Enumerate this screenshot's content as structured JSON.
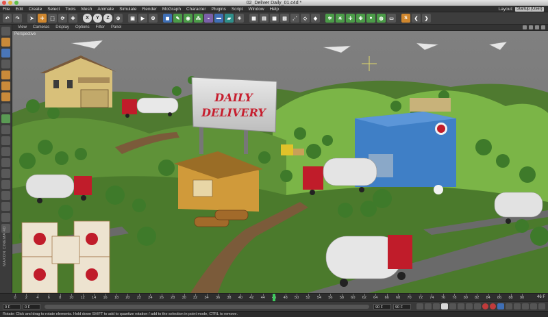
{
  "window": {
    "title": "02_Deliver Daily_01.c4d *"
  },
  "menu": {
    "items": [
      "File",
      "Edit",
      "Create",
      "Select",
      "Tools",
      "Mesh",
      "Animate",
      "Simulate",
      "Render",
      "MoGraph",
      "Character",
      "Plugins",
      "Script",
      "Window",
      "Help"
    ],
    "layout_label": "Layout:",
    "layout_value": "Startup (User)"
  },
  "toolbar": {
    "axis_x": "X",
    "axis_y": "Y",
    "axis_z": "Z"
  },
  "viewport": {
    "menu": [
      "View",
      "Cameras",
      "Display",
      "Options",
      "Filter",
      "Panel"
    ],
    "camera_label": "Perspective",
    "billboard_line1": "DAILY",
    "billboard_line2": "DELIVERY"
  },
  "timeline": {
    "ticks": [
      "0",
      "2",
      "4",
      "6",
      "8",
      "10",
      "12",
      "14",
      "16",
      "18",
      "20",
      "22",
      "24",
      "26",
      "28",
      "30",
      "32",
      "34",
      "36",
      "38",
      "40",
      "42",
      "44",
      "46",
      "48",
      "50",
      "52",
      "54",
      "56",
      "58",
      "60",
      "62",
      "64",
      "66",
      "68",
      "70",
      "72",
      "74",
      "76",
      "78",
      "80",
      "82",
      "84",
      "86",
      "88",
      "90"
    ],
    "current_frame": 46,
    "end_label": "46 F"
  },
  "transport": {
    "start_frame": "0 F",
    "min_field": "0 F",
    "max_field": "90 F",
    "end_frame": "90 F"
  },
  "status": {
    "text": "Rotate: Click and drag to rotate elements. Hold down SHIFT to add to quantize rotation / add to the selection in point mode, CTRL to remove."
  },
  "colors": {
    "grass": "#5a8a3a",
    "hill": "#6fa33f",
    "road": "#6b6b6b",
    "dirt": "#8a6a45",
    "building_blue": "#3f7fc6",
    "billboard_text": "#c61e2e",
    "truck_red": "#c01c2a",
    "timeline_playhead": "#3ecb5c"
  }
}
